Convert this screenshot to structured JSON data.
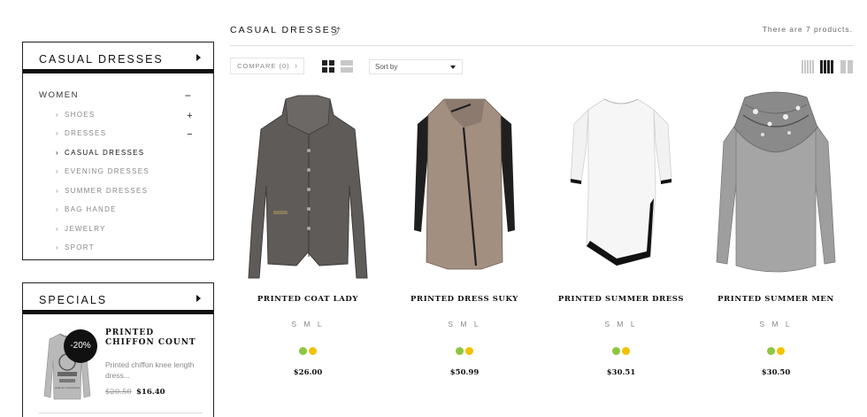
{
  "category_block": {
    "title": "CASUAL DRESSES",
    "root": {
      "label": "WOMEN",
      "toggle": "−"
    },
    "items": [
      {
        "label": "SHOES",
        "toggle": "+",
        "active": false
      },
      {
        "label": "DRESSES",
        "toggle": "−",
        "active": false
      },
      {
        "label": "CASUAL DRESSES",
        "toggle": "",
        "active": true
      },
      {
        "label": "EVENING DRESSES",
        "toggle": "",
        "active": false
      },
      {
        "label": "SUMMER DRESSES",
        "toggle": "",
        "active": false
      },
      {
        "label": "BAG HANDE",
        "toggle": "",
        "active": false
      },
      {
        "label": "JEWELRY",
        "toggle": "",
        "active": false
      },
      {
        "label": "SPORT",
        "toggle": "",
        "active": false
      }
    ],
    "chevron": "›"
  },
  "specials_block": {
    "title": "SPECIALS",
    "item": {
      "badge": "-20%",
      "name": "PRINTED CHIFFON COUNT",
      "description": "Printed chiffon knee length dress...",
      "old_price": "$20.50",
      "new_price": "$16.40",
      "shirt_print": "HARLEY DAVIDSON"
    }
  },
  "main": {
    "title": "CASUAL DRESSES",
    "sort_icon": "⤴",
    "product_count": "There are 7 products.",
    "compare": {
      "label": "COMPARE (0)",
      "arrow": "›"
    },
    "sort": {
      "label": "Sort by"
    }
  },
  "colors": {
    "swatch_green": "#8dc63f",
    "swatch_yellow": "#f2c200",
    "dark": "#111111",
    "muted": "#888888"
  },
  "products": [
    {
      "name": "PRINTED COAT LADY",
      "sizes": "S M L",
      "price": "$26.00",
      "image": "grey-tweed-jacket"
    },
    {
      "name": "PRINTED DRESS SUKY",
      "sizes": "S M L",
      "price": "$50.99",
      "image": "beige-coat-leather-sleeves"
    },
    {
      "name": "PRINTED SUMMER DRESS",
      "sizes": "S M L",
      "price": "$30.51",
      "image": "white-dress-black-trim"
    },
    {
      "name": "PRINTED SUMMER MEN",
      "sizes": "S M L",
      "price": "$30.50",
      "image": "grey-cowl-neck-top"
    }
  ]
}
